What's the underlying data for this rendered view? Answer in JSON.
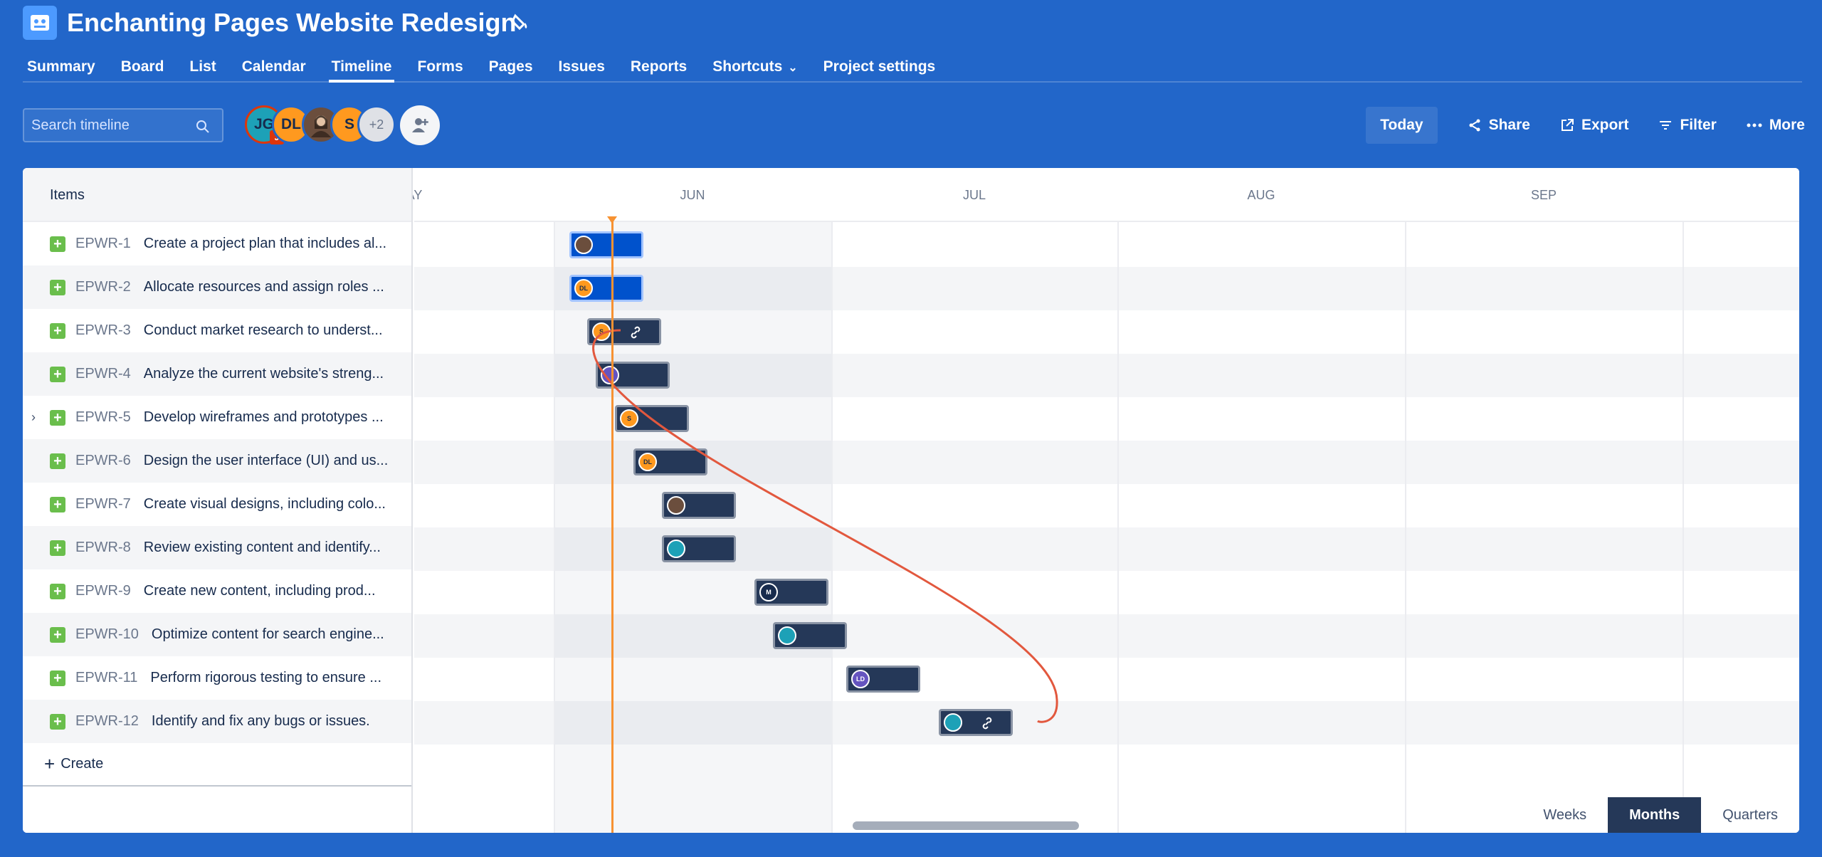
{
  "project": {
    "title": "Enchanting Pages Website Redesign",
    "icon": "project-board-icon"
  },
  "nav": {
    "tabs": [
      "Summary",
      "Board",
      "List",
      "Calendar",
      "Timeline",
      "Forms",
      "Pages",
      "Issues",
      "Reports",
      "Shortcuts",
      "Project settings"
    ],
    "active": "Timeline"
  },
  "toolbar": {
    "search_placeholder": "Search timeline",
    "avatars": [
      "JG",
      "DL",
      "S",
      "+2"
    ],
    "avatar_badge": "J",
    "today_label": "Today",
    "share_label": "Share",
    "export_label": "Export",
    "filter_label": "Filter",
    "more_label": "More"
  },
  "timeline": {
    "items_header": "Items",
    "months": [
      "AY",
      "JUN",
      "JUL",
      "AUG",
      "SEP"
    ],
    "rows": [
      {
        "key": "EPWR-1",
        "summary": "Create a project plan that includes al...",
        "avatar": "",
        "color": "#6b4e3d"
      },
      {
        "key": "EPWR-2",
        "summary": "Allocate resources and assign roles ...",
        "avatar": "DL",
        "color": "#ff991f"
      },
      {
        "key": "EPWR-3",
        "summary": "Conduct market research to underst...",
        "avatar": "S",
        "color": "#ff991f"
      },
      {
        "key": "EPWR-4",
        "summary": "Analyze the current website's streng...",
        "avatar": "",
        "color": "#6554c0"
      },
      {
        "key": "EPWR-5",
        "summary": "Develop wireframes and prototypes ...",
        "avatar": "S",
        "color": "#ff991f"
      },
      {
        "key": "EPWR-6",
        "summary": "Design the user interface (UI) and us...",
        "avatar": "DL",
        "color": "#ff991f"
      },
      {
        "key": "EPWR-7",
        "summary": "Create visual designs, including colo...",
        "avatar": "",
        "color": "#6b4e3d"
      },
      {
        "key": "EPWR-8",
        "summary": "Review existing content and identify...",
        "avatar": "",
        "color": "#1da1b7"
      },
      {
        "key": "EPWR-9",
        "summary": "Create new content, including prod...",
        "avatar": "M",
        "color": "#172b4d"
      },
      {
        "key": "EPWR-10",
        "summary": "Optimize content for search engine...",
        "avatar": "",
        "color": "#1da1b7"
      },
      {
        "key": "EPWR-11",
        "summary": "Perform rigorous testing to ensure ...",
        "avatar": "LD",
        "color": "#6554c0"
      },
      {
        "key": "EPWR-12",
        "summary": "Identify and fix any bugs or issues.",
        "avatar": "",
        "color": "#1da1b7"
      }
    ],
    "create_label": "Create"
  },
  "zoom": {
    "options": [
      "Weeks",
      "Months",
      "Quarters"
    ],
    "active": "Months"
  },
  "colors": {
    "header_bg": "#2266c9",
    "today_line": "#f79232",
    "dependency_line": "#e2583e",
    "bar_dark": "#253858",
    "bar_blue": "#0052cc"
  }
}
